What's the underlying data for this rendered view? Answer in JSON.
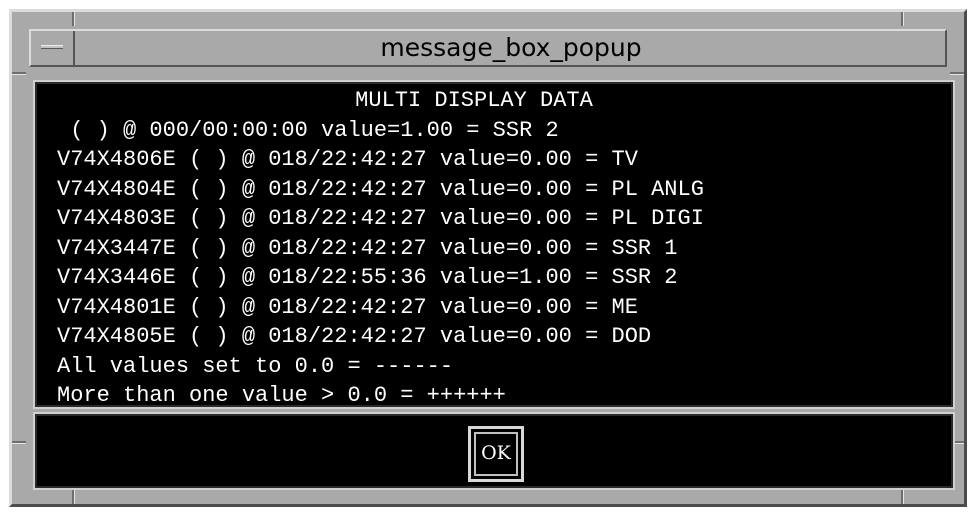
{
  "window": {
    "title": "message_box_popup"
  },
  "message": {
    "heading": "MULTI DISPLAY DATA",
    "lines": [
      " ( ) @ 000/00:00:00 value=1.00 = SSR 2",
      "V74X4806E ( ) @ 018/22:42:27 value=0.00 = TV",
      "V74X4804E ( ) @ 018/22:42:27 value=0.00 = PL ANLG",
      "V74X4803E ( ) @ 018/22:42:27 value=0.00 = PL DIGI",
      "V74X3447E ( ) @ 018/22:42:27 value=0.00 = SSR 1",
      "V74X3446E ( ) @ 018/22:55:36 value=1.00 = SSR 2",
      "V74X4801E ( ) @ 018/22:42:27 value=0.00 = ME",
      "V74X4805E ( ) @ 018/22:42:27 value=0.00 = DOD",
      "All values set to 0.0 = ------",
      "More than one value > 0.0 = ++++++"
    ]
  },
  "buttons": {
    "ok_label": "OK"
  },
  "icons": {
    "window_menu": "window-menu-icon"
  }
}
